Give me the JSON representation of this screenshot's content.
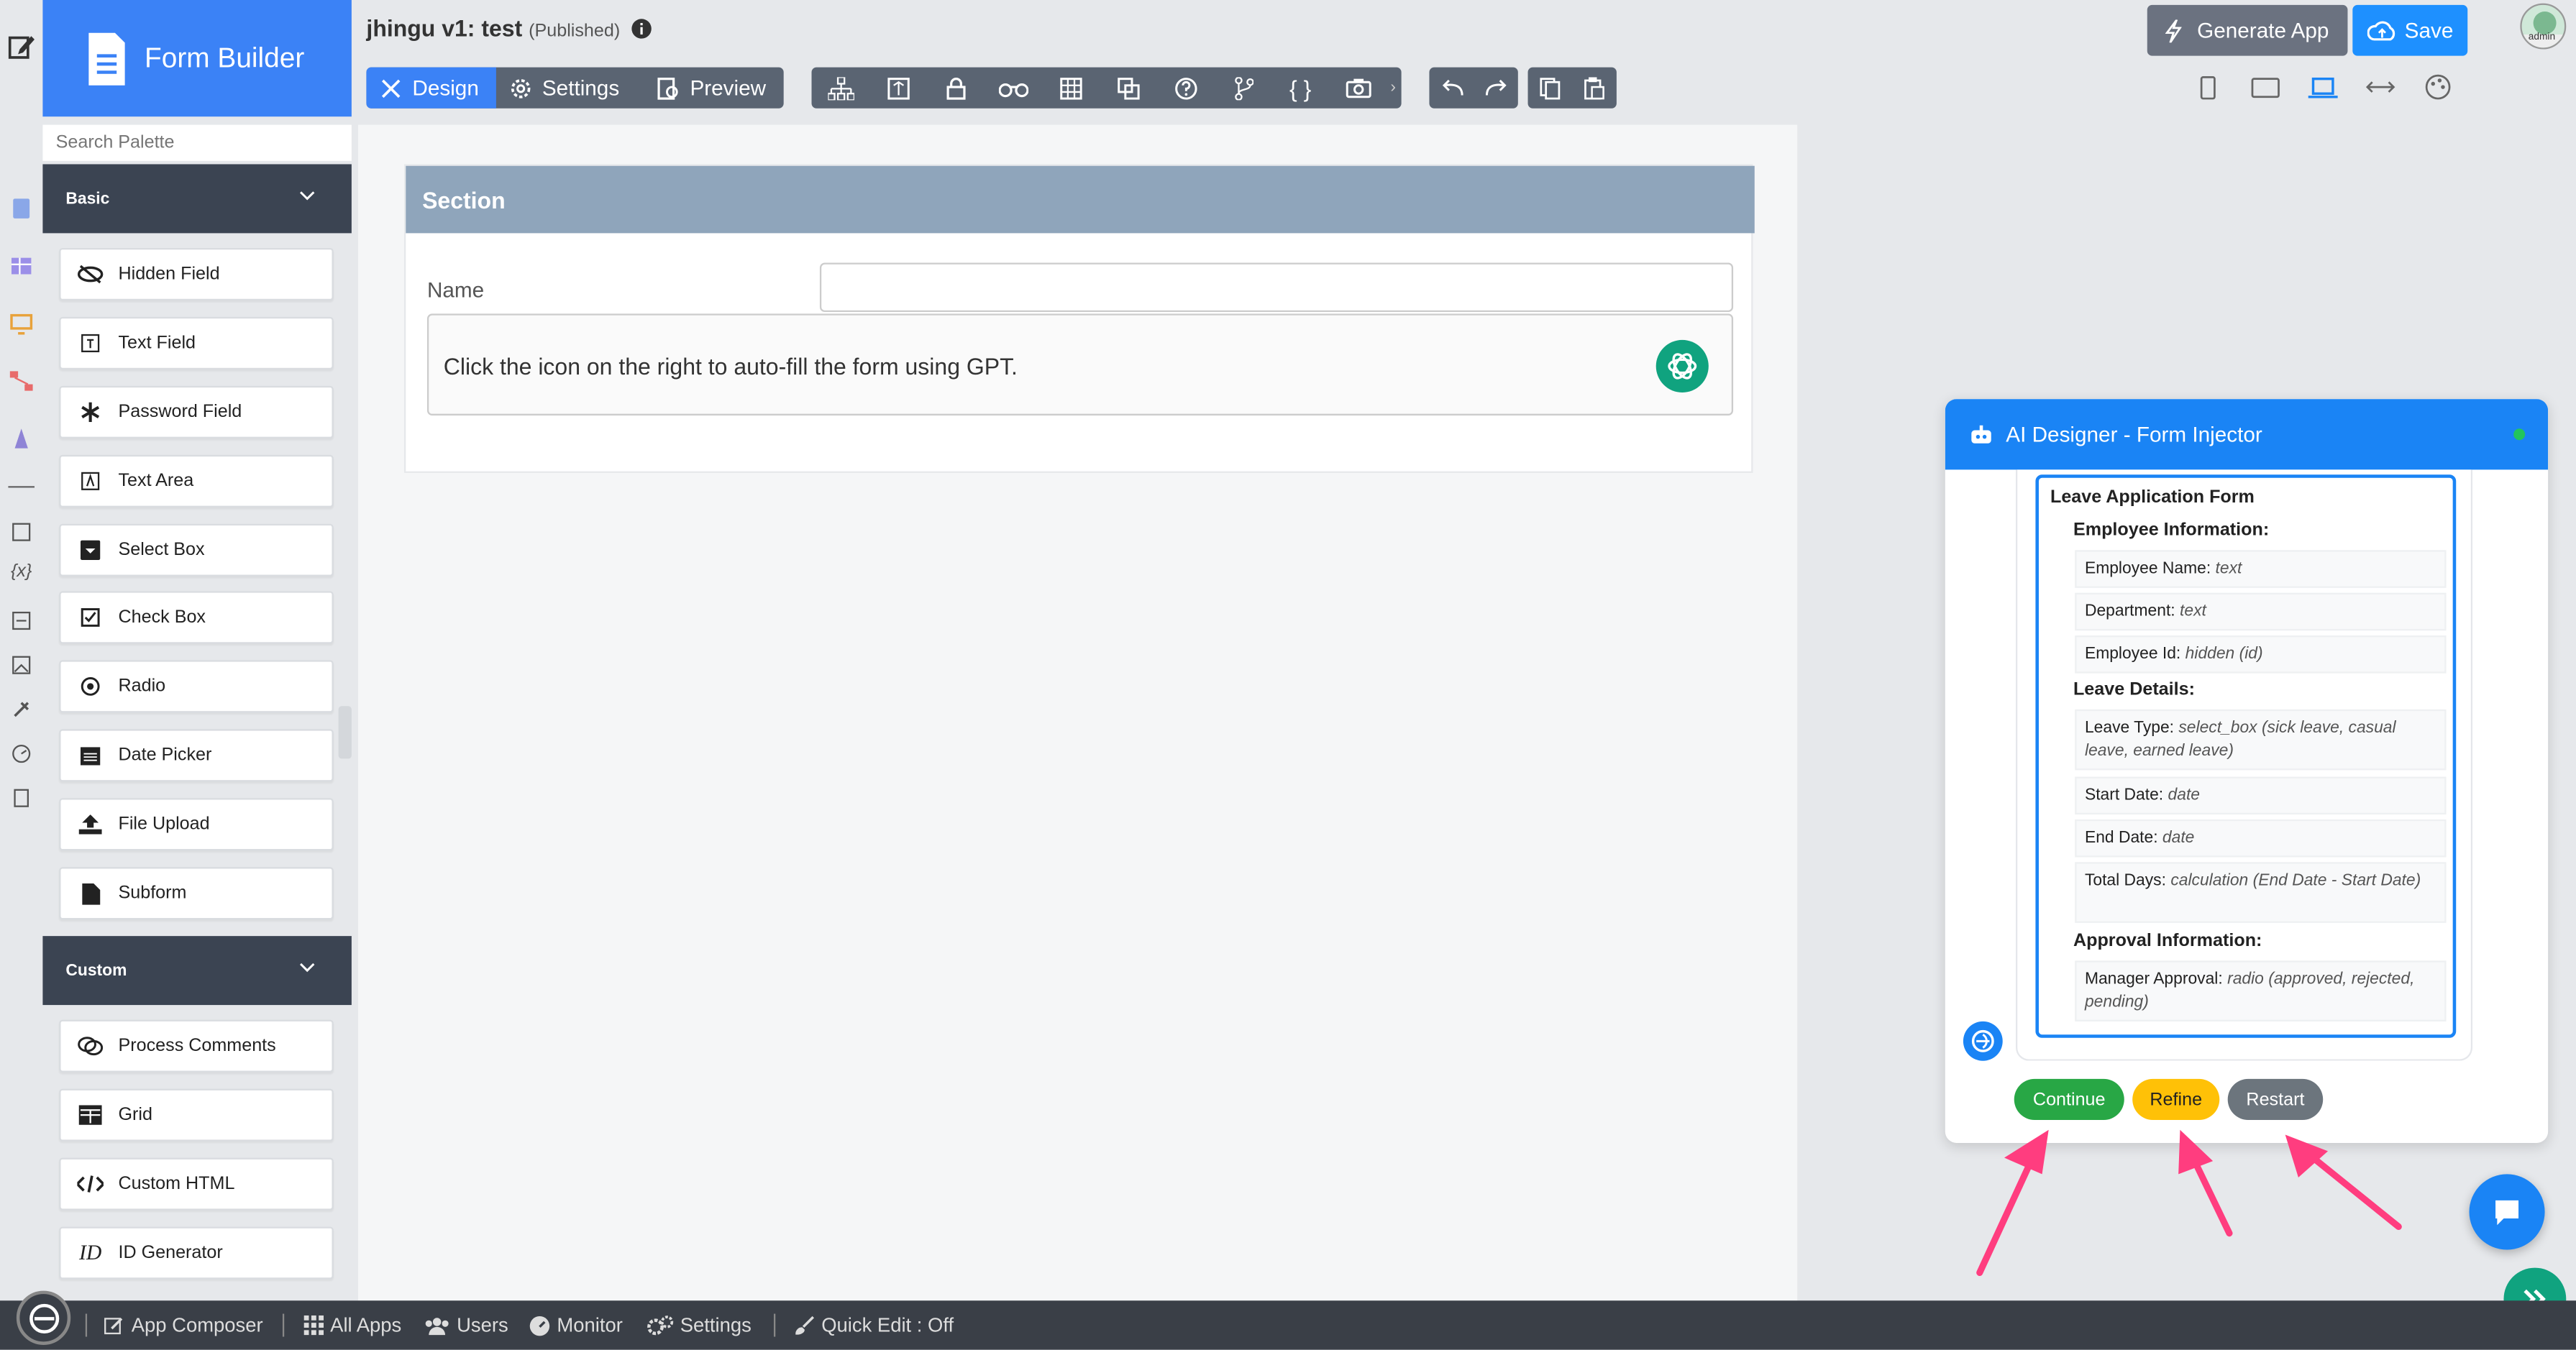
{
  "palette": {
    "title": "Form Builder",
    "search_placeholder": "Search Palette",
    "sections": [
      {
        "label": "Basic",
        "items": [
          "Hidden Field",
          "Text Field",
          "Password Field",
          "Text Area",
          "Select Box",
          "Check Box",
          "Radio",
          "Date Picker",
          "File Upload",
          "Subform"
        ]
      },
      {
        "label": "Custom",
        "items": [
          "Process Comments",
          "Grid",
          "Custom HTML",
          "ID Generator"
        ]
      }
    ]
  },
  "header": {
    "app_name": "jhingu v1: test",
    "status": "(Published)",
    "tabs": {
      "design": "Design",
      "settings": "Settings",
      "preview": "Preview"
    },
    "generate_app": "Generate App",
    "save": "Save",
    "avatar_label": "admin"
  },
  "canvas": {
    "section_title": "Section",
    "name_label": "Name",
    "gpt_hint": "Click the icon on the right to auto-fill the form using GPT."
  },
  "ai_panel": {
    "title": "AI Designer - Form Injector",
    "form_title": "Leave Application Form",
    "groups": [
      {
        "heading": "Employee Information:",
        "fields": [
          {
            "label": "Employee Name:",
            "type": "text"
          },
          {
            "label": "Department:",
            "type": "text"
          },
          {
            "label": "Employee Id:",
            "type": "hidden (id)"
          }
        ]
      },
      {
        "heading": "Leave Details:",
        "fields": [
          {
            "label": "Leave Type:",
            "type": "select_box (sick leave, casual leave, earned leave)"
          },
          {
            "label": "Start Date:",
            "type": "date"
          },
          {
            "label": "End Date:",
            "type": "date"
          },
          {
            "label": "Total Days:",
            "type": "calculation (End Date - Start Date)"
          }
        ]
      },
      {
        "heading": "Approval Information:",
        "fields": [
          {
            "label": "Manager Approval:",
            "type": "radio (approved, rejected, pending)"
          }
        ]
      }
    ],
    "buttons": {
      "continue": "Continue",
      "refine": "Refine",
      "restart": "Restart"
    },
    "colors": {
      "continue": "#28a745",
      "refine": "#ffc107",
      "restart": "#6c757d"
    }
  },
  "bottom_bar": {
    "app_composer": "App Composer",
    "all_apps": "All Apps",
    "users": "Users",
    "monitor": "Monitor",
    "settings": "Settings",
    "quick_edit": "Quick Edit : Off"
  }
}
